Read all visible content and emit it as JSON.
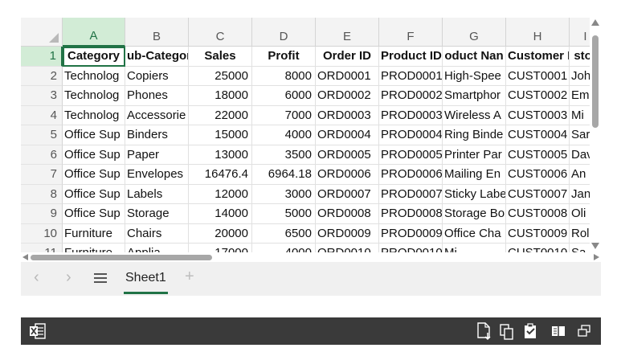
{
  "colors": {
    "accent": "#217346",
    "selected_header_bg": "#d2ecd6",
    "status_bar_bg": "#3a3a3a"
  },
  "columns": [
    "A",
    "B",
    "C",
    "D",
    "E",
    "F",
    "G",
    "H",
    "I"
  ],
  "row_numbers": [
    "1",
    "2",
    "3",
    "4",
    "5",
    "6",
    "7",
    "8",
    "9",
    "10",
    "11"
  ],
  "rows": [
    [
      "Category",
      "ub-Categor",
      "Sales",
      "Profit",
      "Order ID",
      "Product ID",
      "oduct Nan",
      "Customer II",
      "stor"
    ],
    [
      "Technolog",
      "Copiers",
      "25000",
      "8000",
      "ORD0001",
      "PROD0001",
      "High-Spee",
      "CUST0001",
      "Joh"
    ],
    [
      "Technolog",
      "Phones",
      "18000",
      "6000",
      "ORD0002",
      "PROD0002",
      "Smartphor",
      "CUST0002",
      "Em"
    ],
    [
      "Technolog",
      "Accessorie",
      "22000",
      "7000",
      "ORD0003",
      "PROD0003",
      "Wireless A",
      "CUST0003",
      "Mi"
    ],
    [
      "Office Sup",
      "Binders",
      "15000",
      "4000",
      "ORD0004",
      "PROD0004",
      "Ring Binde",
      "CUST0004",
      "Sar"
    ],
    [
      "Office Sup",
      "Paper",
      "13000",
      "3500",
      "ORD0005",
      "PROD0005",
      "Printer Par",
      "CUST0005",
      "Dav"
    ],
    [
      "Office Sup",
      "Envelopes",
      "16476.4",
      "6964.18",
      "ORD0006",
      "PROD0006",
      "Mailing En",
      "CUST0006",
      "An"
    ],
    [
      "Office Sup",
      "Labels",
      "12000",
      "3000",
      "ORD0007",
      "PROD0007",
      "Sticky Labe",
      "CUST0007",
      "Jan"
    ],
    [
      "Office Sup",
      "Storage",
      "14000",
      "5000",
      "ORD0008",
      "PROD0008",
      "Storage Bo",
      "CUST0008",
      "Oli"
    ],
    [
      "Furniture",
      "Chairs",
      "20000",
      "6500",
      "ORD0009",
      "PROD0009",
      "Office Cha",
      "CUST0009",
      "Rol"
    ],
    [
      "Furniture",
      "Applia",
      "17000",
      "4000",
      "ORD0010",
      "PROD0010",
      "Mi",
      "CUST0010",
      "Sa"
    ]
  ],
  "sheet_tabs": {
    "active": "Sheet1",
    "add_label": "+"
  },
  "nav": {
    "prev": "‹",
    "next": "›"
  },
  "icons": {
    "app": "excel-app-icon",
    "status": [
      "save-to-device-icon",
      "copy-document-icon",
      "clipboard-icon",
      "reading-view-icon",
      "restore-window-icon"
    ]
  }
}
